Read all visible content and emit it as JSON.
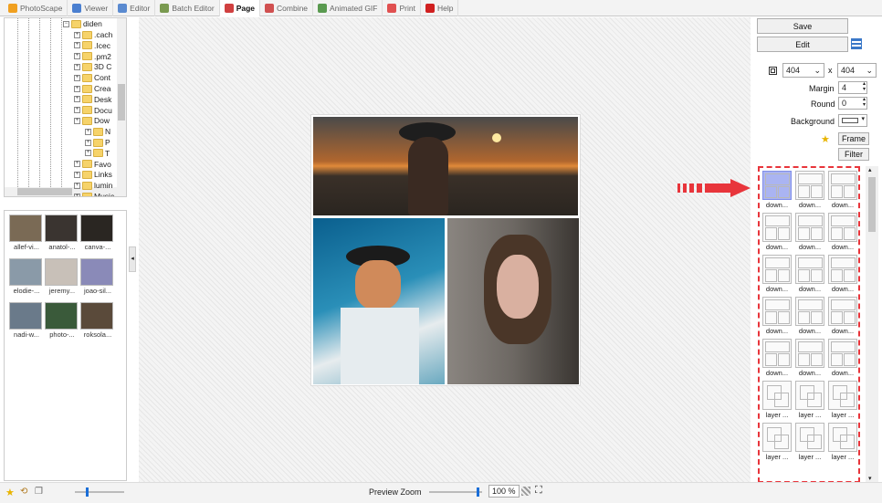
{
  "tabs": [
    {
      "label": "PhotoScape",
      "color": "#f0a020"
    },
    {
      "label": "Viewer",
      "color": "#4a7fd0"
    },
    {
      "label": "Editor",
      "color": "#5a8ad0"
    },
    {
      "label": "Batch Editor",
      "color": "#7a9a50"
    },
    {
      "label": "Page",
      "color": "#d04040"
    },
    {
      "label": "Combine",
      "color": "#d05050"
    },
    {
      "label": "Animated GIF",
      "color": "#5a9a50"
    },
    {
      "label": "Print",
      "color": "#e05050"
    },
    {
      "label": "Help",
      "color": "#d02020"
    }
  ],
  "tree": {
    "items": [
      ".cach",
      ".Icec",
      ".pm2",
      "3D C",
      "Cont",
      "Crea",
      "Desk",
      "Docu",
      "Dow",
      "N",
      "P",
      "T",
      "Favo",
      "Links",
      "lumin",
      "Music"
    ],
    "root": "diden"
  },
  "thumbs": [
    {
      "label": "allef-vi..."
    },
    {
      "label": "anatol-..."
    },
    {
      "label": "canva-..."
    },
    {
      "label": "elodie-..."
    },
    {
      "label": "jeremy..."
    },
    {
      "label": "joao-sil..."
    },
    {
      "label": "nadi-w..."
    },
    {
      "label": "photo-..."
    },
    {
      "label": "roksola..."
    }
  ],
  "panel": {
    "save": "Save",
    "edit": "Edit",
    "width": "404",
    "height": "404",
    "x": "x",
    "margin_label": "Margin",
    "margin": "4",
    "round_label": "Round",
    "round": "0",
    "background_label": "Background",
    "frame": "Frame",
    "filter": "Filter"
  },
  "templates": [
    "down...",
    "down...",
    "down...",
    "down...",
    "down...",
    "down...",
    "down...",
    "down...",
    "down...",
    "down...",
    "down...",
    "down...",
    "down...",
    "down...",
    "down...",
    "layer ...",
    "layer ...",
    "layer ...",
    "layer ...",
    "layer ...",
    "layer ..."
  ],
  "status": {
    "preview_zoom": "Preview Zoom",
    "zoom": "100 %"
  },
  "colors": {
    "accent": "#e8353b",
    "selected": "#aab4f2"
  }
}
